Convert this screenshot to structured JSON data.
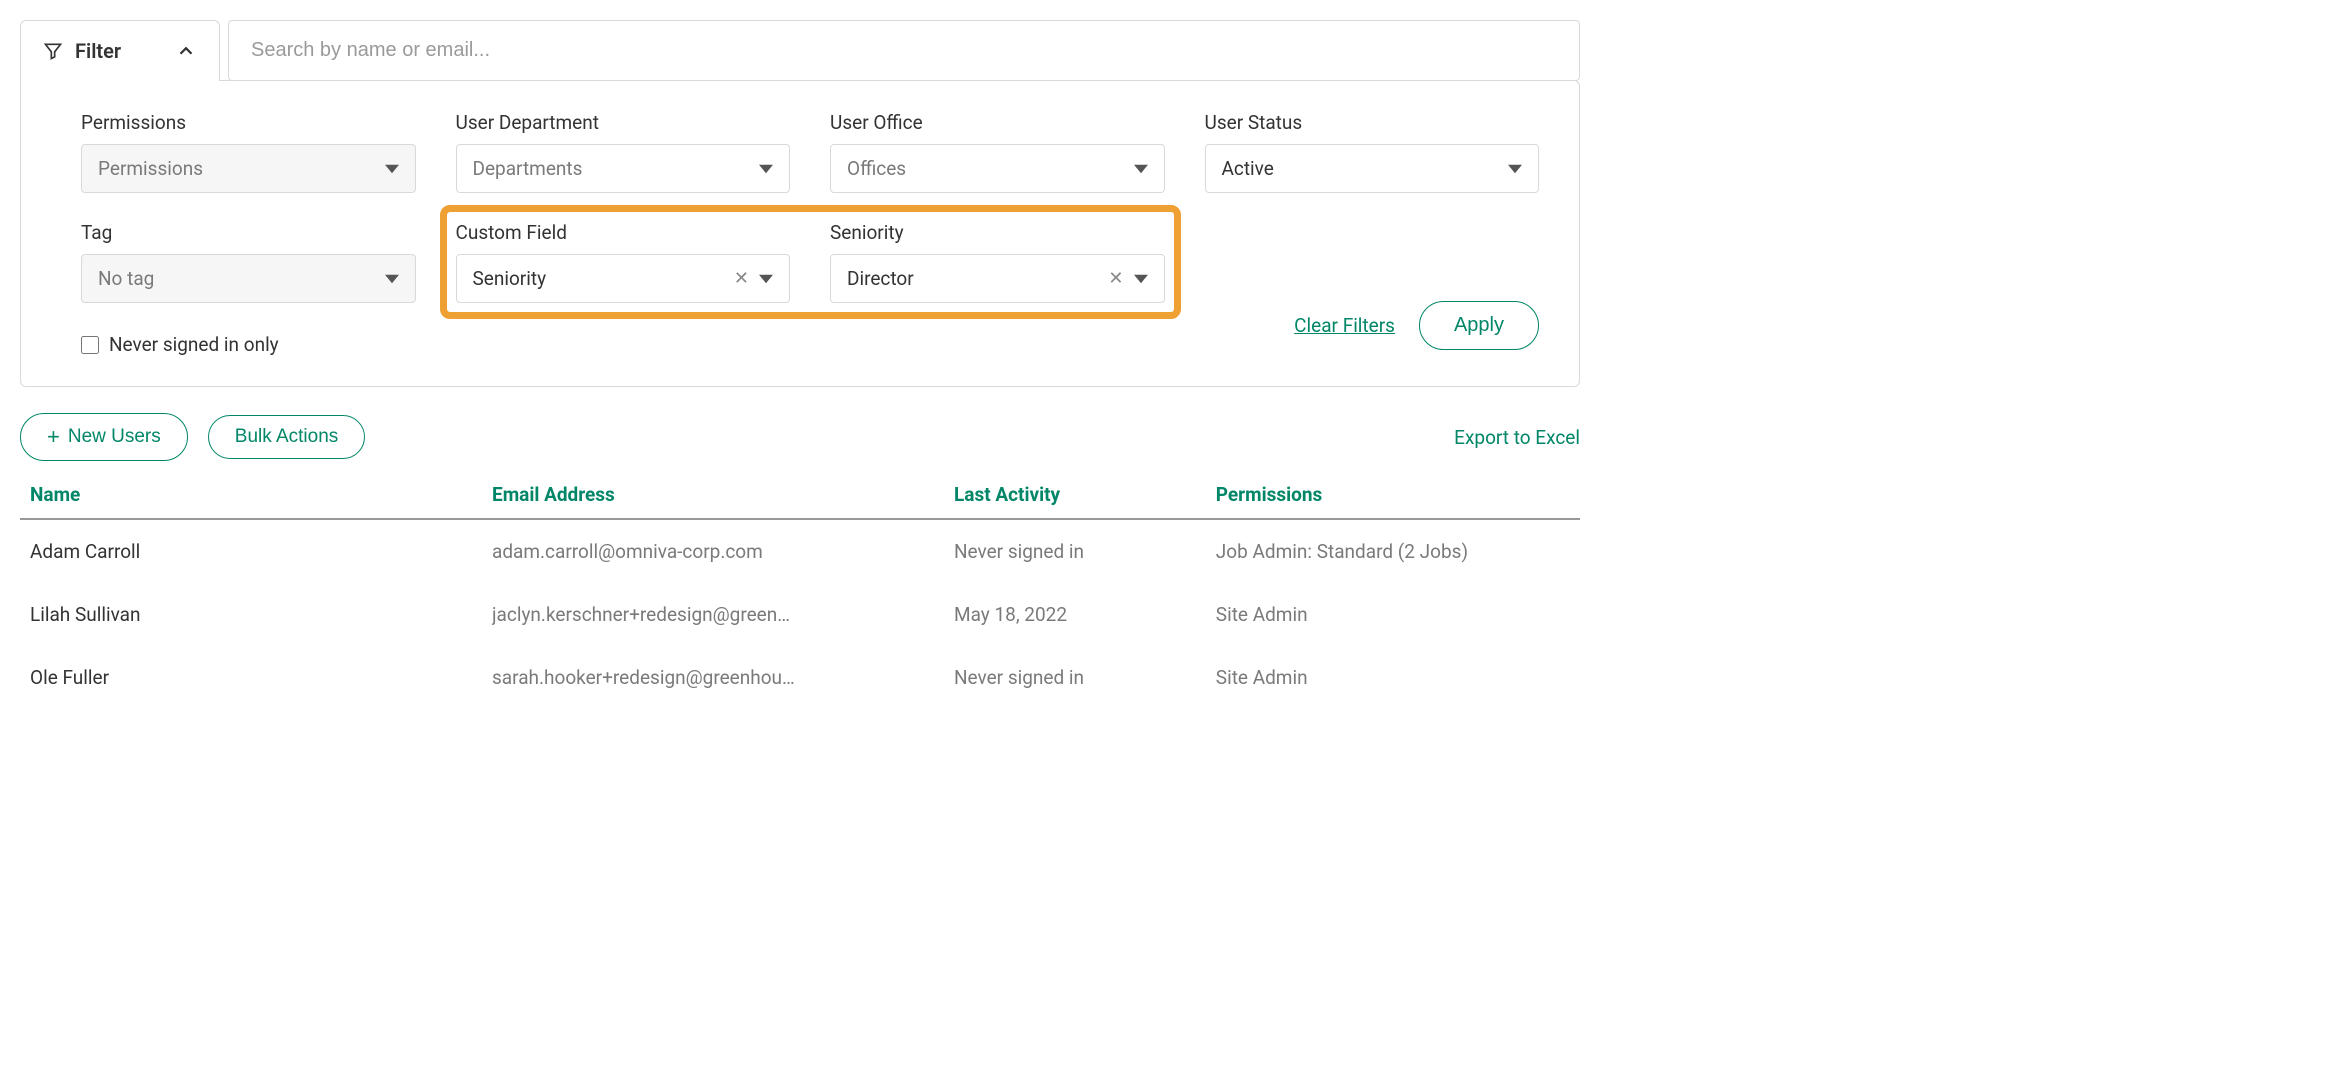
{
  "filter_tab": {
    "label": "Filter"
  },
  "search": {
    "placeholder": "Search by name or email..."
  },
  "filters": {
    "permissions": {
      "label": "Permissions",
      "placeholder": "Permissions"
    },
    "user_department": {
      "label": "User Department",
      "placeholder": "Departments"
    },
    "user_office": {
      "label": "User Office",
      "placeholder": "Offices"
    },
    "user_status": {
      "label": "User Status",
      "value": "Active"
    },
    "tag": {
      "label": "Tag",
      "placeholder": "No tag"
    },
    "custom_field": {
      "label": "Custom Field",
      "value": "Seniority"
    },
    "seniority": {
      "label": "Seniority",
      "value": "Director"
    },
    "never_signed_in": {
      "label": "Never signed in only",
      "checked": false
    }
  },
  "panel": {
    "clear_label": "Clear Filters",
    "apply_label": "Apply"
  },
  "actions": {
    "new_users": "New Users",
    "bulk_actions": "Bulk Actions",
    "export": "Export to Excel"
  },
  "table": {
    "headers": {
      "name": "Name",
      "email": "Email Address",
      "last_activity": "Last Activity",
      "permissions": "Permissions"
    },
    "rows": [
      {
        "name": "Adam Carroll",
        "email": "adam.carroll@omniva-corp.com",
        "last_activity": "Never signed in",
        "permissions": "Job Admin: Standard (2 Jobs)"
      },
      {
        "name": "Lilah Sullivan",
        "email": "jaclyn.kerschner+redesign@green…",
        "last_activity": "May 18, 2022",
        "permissions": "Site Admin"
      },
      {
        "name": "Ole Fuller",
        "email": "sarah.hooker+redesign@greenhou…",
        "last_activity": "Never signed in",
        "permissions": "Site Admin"
      }
    ]
  }
}
